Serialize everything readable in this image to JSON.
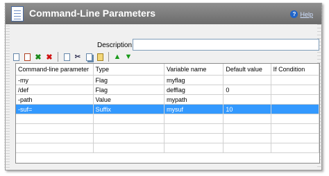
{
  "window": {
    "title": "Command-Line Parameters",
    "help_label": "Help"
  },
  "description": {
    "label": "Description:",
    "value": ""
  },
  "toolbar": [
    {
      "name": "new-icon"
    },
    {
      "name": "edit-icon"
    },
    {
      "name": "check-icon"
    },
    {
      "name": "delete-icon"
    },
    {
      "name": "copy-icon"
    },
    {
      "name": "cut-icon"
    },
    {
      "name": "duplicate-icon"
    },
    {
      "name": "paste-icon"
    },
    {
      "name": "move-up-icon"
    },
    {
      "name": "move-down-icon"
    }
  ],
  "table": {
    "columns": [
      "Command-line parameter",
      "Type",
      "Variable name",
      "Default value",
      "If Condition"
    ],
    "rows": [
      [
        "-my",
        "Flag",
        "myflag",
        "",
        ""
      ],
      [
        "/def",
        "Flag",
        "defflag",
        "0",
        ""
      ],
      [
        "-path",
        "Value",
        "mypath",
        "",
        ""
      ],
      [
        "-suf=",
        "Suffix",
        "mysuf",
        "10",
        ""
      ]
    ],
    "selected_row": 3
  },
  "colors": {
    "selection": "#3399ff",
    "titlebar": "#7d7d7d"
  }
}
